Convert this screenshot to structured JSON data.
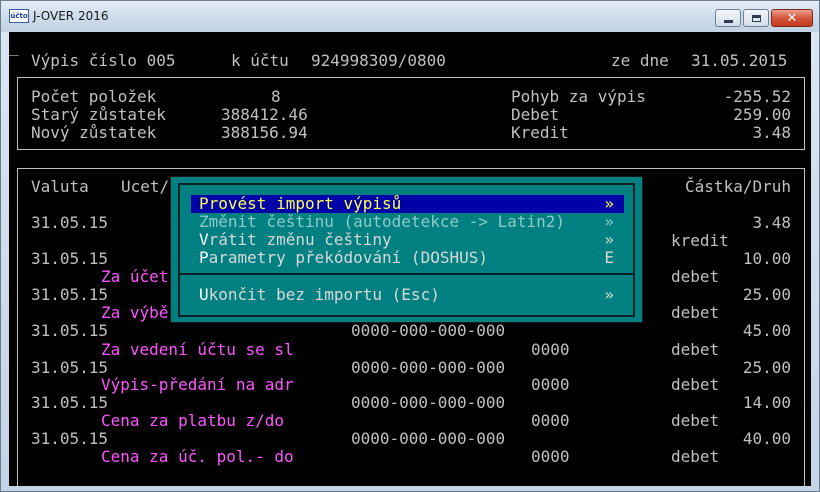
{
  "window": {
    "title": "J-OVER 2016",
    "app_icon_text": "účto"
  },
  "header": {
    "cursor": "_",
    "statement_label": "Výpis číslo 005",
    "account_label": "k účtu",
    "account_number": "924998309/0800",
    "date_label": "ze dne",
    "date_value": "31.05.2015"
  },
  "summary": {
    "item_count_label": "Počet položek",
    "item_count_value": "8",
    "old_balance_label": "Starý zůstatek",
    "old_balance_value": "388412.46",
    "new_balance_label": "Nový zůstatek",
    "new_balance_value": "388156.94",
    "movement_label": "Pohyb za výpis",
    "movement_value": "-255.52",
    "debit_label": "Debet",
    "debit_value": "259.00",
    "credit_label": "Kredit",
    "credit_value": "3.48"
  },
  "table": {
    "col_valuta": "Valuta",
    "col_account": "Ucet/",
    "col_amount": "Částka/Druh",
    "rows": [
      {
        "date": "31.05.15",
        "desc": "",
        "account": "",
        "code": "",
        "amount": "3.48",
        "kind": "kredit"
      },
      {
        "date": "31.05.15",
        "desc": "Za účet",
        "account": "",
        "code": "",
        "amount": "10.00",
        "kind": "debet"
      },
      {
        "date": "31.05.15",
        "desc": "Za výbě",
        "account": "",
        "code": "",
        "amount": "25.00",
        "kind": "debet"
      },
      {
        "date": "31.05.15",
        "desc": "Za vedení účtu se sl",
        "account": "0000-000-000-000",
        "code": "0000",
        "amount": "45.00",
        "kind": "debet"
      },
      {
        "date": "31.05.15",
        "desc": "Výpis-předání na adr",
        "account": "0000-000-000-000",
        "code": "0000",
        "amount": "25.00",
        "kind": "debet"
      },
      {
        "date": "31.05.15",
        "desc": "Cena za platbu z/do",
        "account": "0000-000-000-000",
        "code": "0000",
        "amount": "14.00",
        "kind": "debet"
      },
      {
        "date": "31.05.15",
        "desc": "Cena za úč. pol.- do",
        "account": "0000-000-000-000",
        "code": "0000",
        "amount": "40.00",
        "kind": "debet"
      }
    ]
  },
  "menu": {
    "items": [
      {
        "hotkey": "",
        "label": "Provést import výpisů",
        "accel": "»",
        "state": "selected"
      },
      {
        "hotkey": "",
        "label": "Změnit češtinu (autodetekce -> Latin2)",
        "accel": "»",
        "state": "disabled"
      },
      {
        "hotkey": "V",
        "label": "rátit změnu češtiny",
        "accel": "»",
        "state": "normal"
      },
      {
        "hotkey": "P",
        "label": "arametry překódování (DOSHUS)",
        "accel": "E",
        "state": "normal"
      },
      {
        "hotkey": "U",
        "label": "končit bez importu (Esc)",
        "accel": "»",
        "state": "normal"
      }
    ]
  },
  "colors": {
    "console_bg": "#000000",
    "console_text": "#c0c0c0",
    "description_text": "#ff55ff",
    "menu_bg": "#008080",
    "menu_selected_bg": "#0000a8",
    "menu_selected_text": "#ffff55"
  }
}
